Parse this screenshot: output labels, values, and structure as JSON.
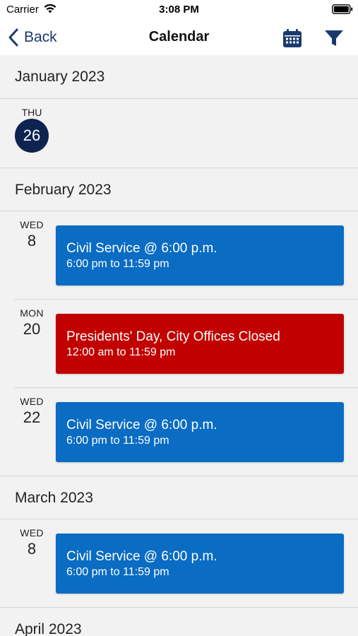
{
  "status_bar": {
    "carrier": "Carrier",
    "time": "3:08 PM"
  },
  "nav": {
    "back_label": "Back",
    "title": "Calendar",
    "accent_color": "#1a3a6e"
  },
  "months": [
    {
      "title": "January 2023",
      "days": [
        {
          "dow": "THU",
          "day": "26",
          "today": true,
          "events": []
        }
      ]
    },
    {
      "title": "February 2023",
      "days": [
        {
          "dow": "WED",
          "day": "8",
          "events": [
            {
              "title": "Civil Service @ 6:00 p.m.",
              "time": "6:00 pm to 11:59 pm",
              "color": "#0a6cc3"
            }
          ]
        },
        {
          "dow": "MON",
          "day": "20",
          "events": [
            {
              "title": "Presidents' Day, City Offices Closed",
              "time": "12:00 am to 11:59 pm",
              "color": "#c10000"
            }
          ]
        },
        {
          "dow": "WED",
          "day": "22",
          "events": [
            {
              "title": "Civil Service @ 6:00 p.m.",
              "time": "6:00 pm to 11:59 pm",
              "color": "#0a6cc3"
            }
          ]
        }
      ]
    },
    {
      "title": "March 2023",
      "days": [
        {
          "dow": "WED",
          "day": "8",
          "events": [
            {
              "title": "Civil Service @ 6:00 p.m.",
              "time": "6:00 pm to 11:59 pm",
              "color": "#0a6cc3"
            }
          ]
        }
      ]
    },
    {
      "title": "April 2023",
      "days": []
    }
  ]
}
